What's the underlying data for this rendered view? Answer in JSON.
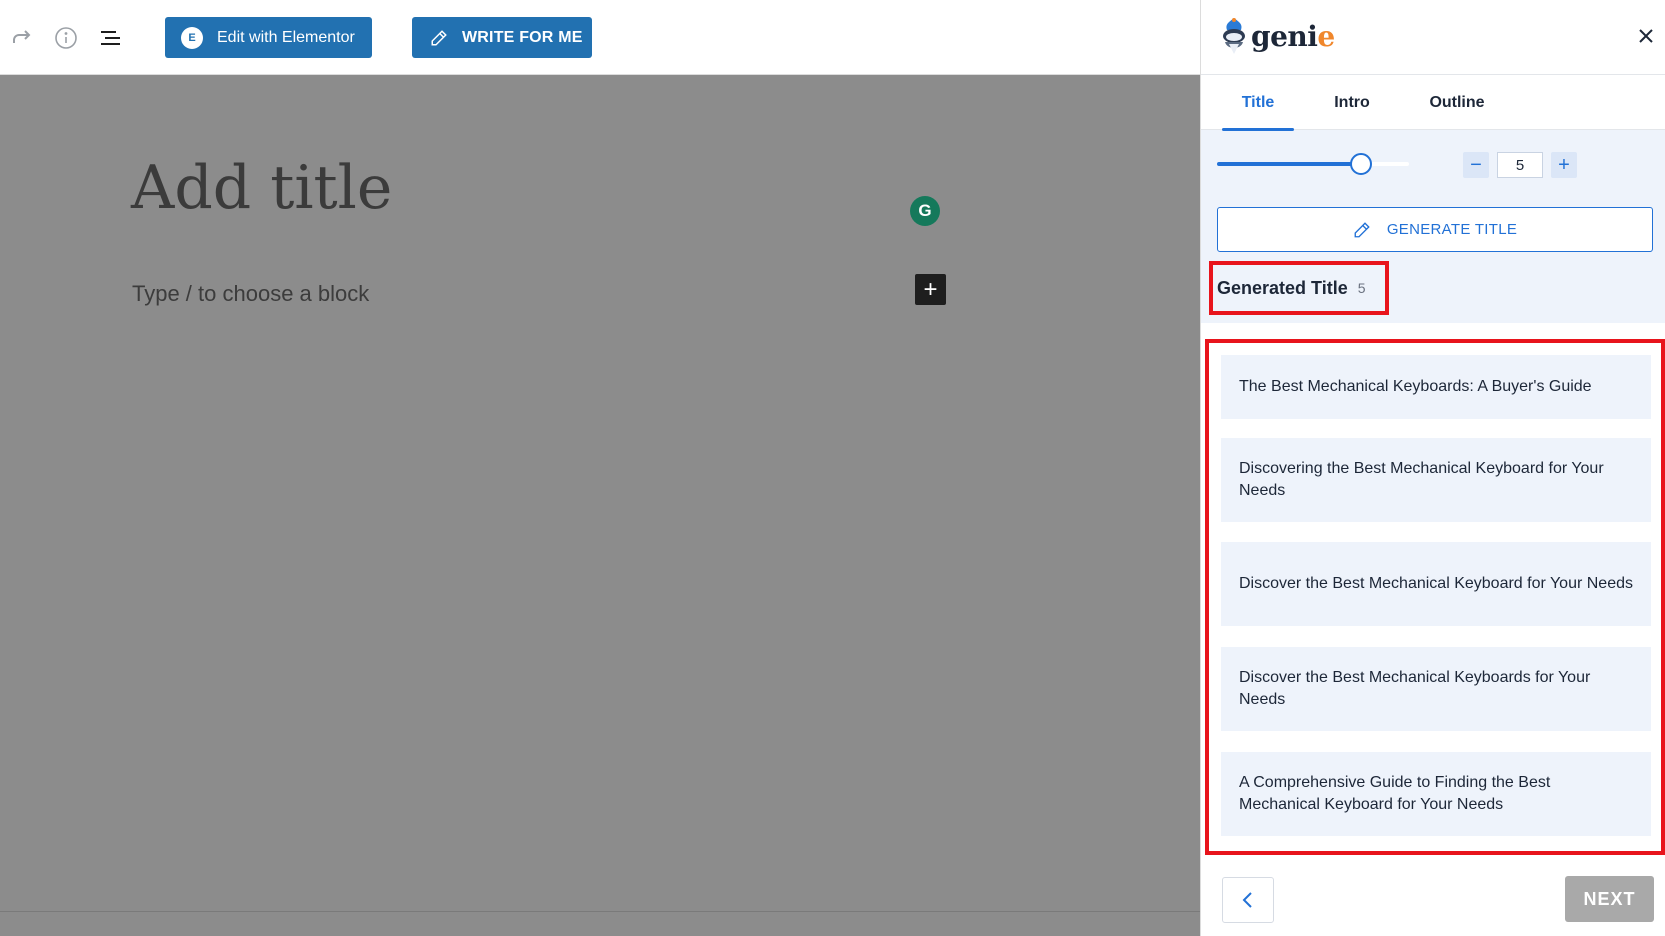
{
  "toolbar": {
    "redo_icon": "redo-icon",
    "info_icon": "info-icon",
    "list_view_icon": "list-view-icon",
    "elementor_label": "Edit with Elementor",
    "elementor_logo": "E",
    "write_label": "WRITE FOR ME"
  },
  "editor": {
    "title_placeholder": "Add title",
    "block_placeholder": "Type / to choose a block",
    "grammarly_letter": "G",
    "add_block_label": "+"
  },
  "panel": {
    "logo_text_pre": "geni",
    "logo_text_post": "e",
    "tabs": [
      {
        "label": "Title",
        "active": true
      },
      {
        "label": "Intro",
        "active": false
      },
      {
        "label": "Outline",
        "active": false
      }
    ],
    "slider": {
      "value": 0.75
    },
    "stepper": {
      "minus": "−",
      "value": "5",
      "plus": "+"
    },
    "generate_button": "GENERATE TITLE",
    "generated_heading": "Generated Title",
    "generated_count": "5",
    "results": [
      "The Best Mechanical Keyboards: A Buyer's Guide",
      "Discovering the Best Mechanical Keyboard for Your Needs",
      "Discover the Best Mechanical Keyboard for Your Needs",
      "Discover the Best Mechanical Keyboards for Your Needs",
      "A Comprehensive Guide to Finding the Best Mechanical Keyboard for Your Needs"
    ],
    "next_button": "NEXT"
  },
  "colors": {
    "accent": "#2271d6",
    "wp_blue": "#2271b1",
    "highlight_red": "#e8141c",
    "canvas_gray": "#8c8c8c"
  }
}
